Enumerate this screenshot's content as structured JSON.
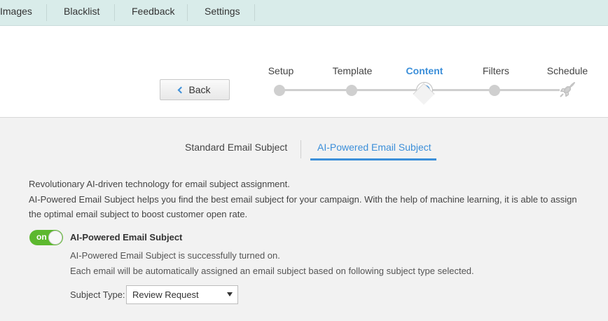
{
  "nav": {
    "items": [
      "Images",
      "Blacklist",
      "Feedback",
      "Settings"
    ]
  },
  "wizard": {
    "back_label": "Back",
    "steps": [
      "Setup",
      "Template",
      "Content",
      "Filters",
      "Schedule"
    ],
    "active_step": "Content"
  },
  "tabs": {
    "standard": "Standard Email Subject",
    "ai": "AI-Powered Email Subject",
    "active": "AI-Powered Email Subject"
  },
  "description": {
    "line1": "Revolutionary AI-driven technology for email subject assignment.",
    "line2": "AI-Powered Email Subject helps you find the best email subject for your campaign. With the help of machine learning, it is able to assign",
    "line3": "the optimal email subject to boost customer open rate."
  },
  "toggle": {
    "state": "on",
    "label": "AI-Powered Email Subject"
  },
  "status": {
    "line1": "AI-Powered Email Subject is successfully turned on.",
    "line2": "Each email will be automatically assigned an email subject based on following subject type selected."
  },
  "subject_type": {
    "label": "Subject Type:",
    "value": "Review Request"
  },
  "colors": {
    "accent": "#3c8fd9",
    "toggle_on": "#5cb82e",
    "nav_bg": "#d9ecea",
    "content_bg": "#f2f2f2"
  }
}
